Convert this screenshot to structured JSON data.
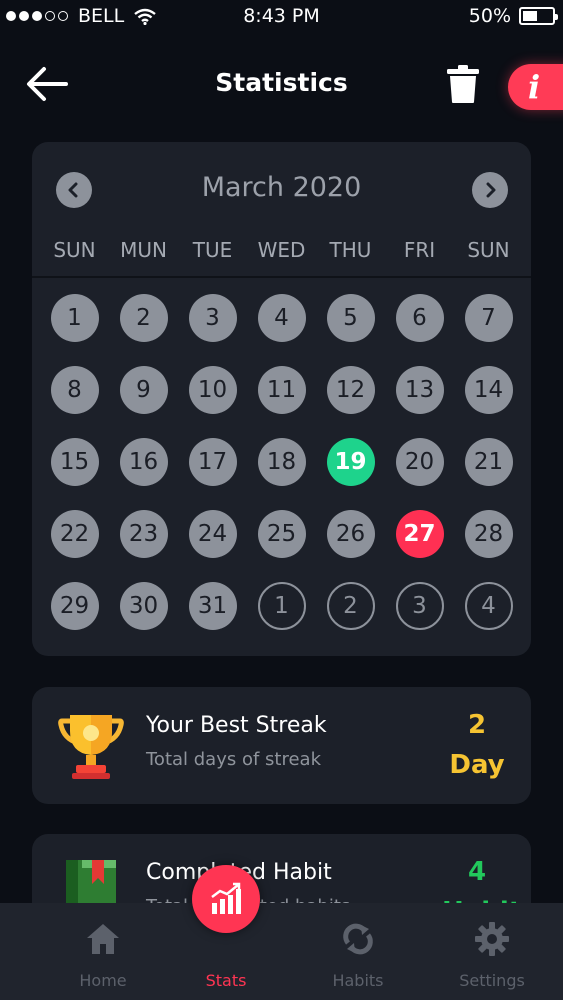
{
  "status_bar": {
    "carrier": "BELL",
    "time": "8:43 PM",
    "battery": "50%",
    "battery_level": 0.5
  },
  "header": {
    "title": "Statistics",
    "info_label": "i"
  },
  "calendar": {
    "month": "March 2020",
    "weekdays": [
      "SUN",
      "MUN",
      "TUE",
      "WED",
      "THU",
      "FRI",
      "SUN"
    ],
    "days": [
      {
        "label": "1",
        "state": "normal"
      },
      {
        "label": "2",
        "state": "normal"
      },
      {
        "label": "3",
        "state": "normal"
      },
      {
        "label": "4",
        "state": "normal"
      },
      {
        "label": "5",
        "state": "normal"
      },
      {
        "label": "6",
        "state": "normal"
      },
      {
        "label": "7",
        "state": "normal"
      },
      {
        "label": "8",
        "state": "normal"
      },
      {
        "label": "9",
        "state": "normal"
      },
      {
        "label": "10",
        "state": "normal"
      },
      {
        "label": "11",
        "state": "normal"
      },
      {
        "label": "12",
        "state": "normal"
      },
      {
        "label": "13",
        "state": "normal"
      },
      {
        "label": "14",
        "state": "normal"
      },
      {
        "label": "15",
        "state": "normal"
      },
      {
        "label": "16",
        "state": "normal"
      },
      {
        "label": "17",
        "state": "normal"
      },
      {
        "label": "18",
        "state": "normal"
      },
      {
        "label": "19",
        "state": "green"
      },
      {
        "label": "20",
        "state": "normal"
      },
      {
        "label": "21",
        "state": "normal"
      },
      {
        "label": "22",
        "state": "normal"
      },
      {
        "label": "23",
        "state": "normal"
      },
      {
        "label": "24",
        "state": "normal"
      },
      {
        "label": "25",
        "state": "normal"
      },
      {
        "label": "26",
        "state": "normal"
      },
      {
        "label": "27",
        "state": "red"
      },
      {
        "label": "28",
        "state": "normal"
      },
      {
        "label": "29",
        "state": "normal"
      },
      {
        "label": "30",
        "state": "normal"
      },
      {
        "label": "31",
        "state": "normal"
      },
      {
        "label": "1",
        "state": "other"
      },
      {
        "label": "2",
        "state": "other"
      },
      {
        "label": "3",
        "state": "other"
      },
      {
        "label": "4",
        "state": "other"
      }
    ]
  },
  "streak": {
    "title": "Your Best Streak",
    "subtitle": "Total days of streak",
    "value": "2",
    "unit": "Day",
    "icon": "trophy-icon"
  },
  "completed": {
    "title": "Completed Habit",
    "subtitle": "Total completed habits",
    "value": "4",
    "unit": "Habit",
    "icon": "book-icon"
  },
  "bottom_nav": {
    "home": "Home",
    "stats": "Stats",
    "habits": "Habits",
    "settings": "Settings"
  },
  "colors": {
    "background": "#0b0e15",
    "card": "#1c2029",
    "accent_red": "#ff3553",
    "accent_green": "#1ed38c",
    "streak_yellow": "#f6c432",
    "habit_green": "#22c95c"
  }
}
